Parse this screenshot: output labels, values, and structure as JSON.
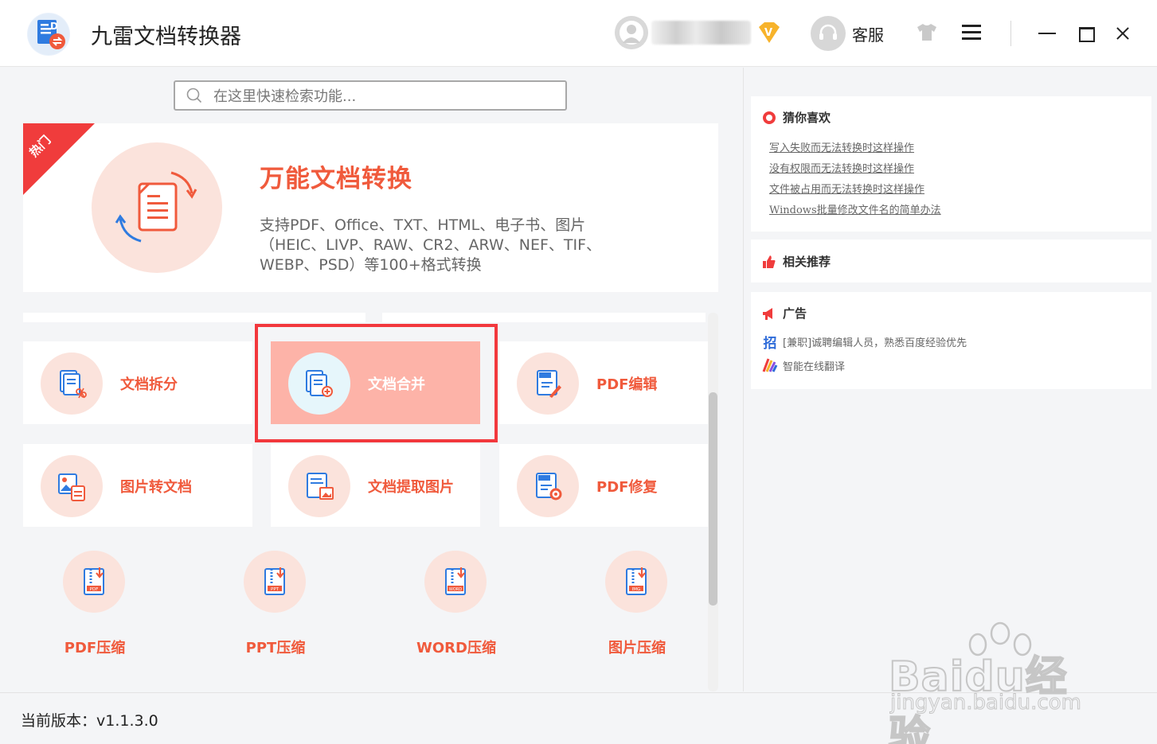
{
  "app": {
    "title": "九雷文档转换器"
  },
  "header": {
    "support_label": "客服",
    "vip_badge": "V"
  },
  "search": {
    "placeholder": "在这里快速检索功能..."
  },
  "hero": {
    "hot_label": "热门",
    "title": "万能文档转换",
    "description": "支持PDF、Office、TXT、HTML、电子书、图片（HEIC、LIVP、RAW、CR2、ARW、NEF、TIF、WEBP、PSD）等100+格式转换"
  },
  "tools": [
    {
      "label": "文档拆分",
      "icon": "document-split-icon"
    },
    {
      "label": "文档合并",
      "icon": "document-merge-icon",
      "selected": true
    },
    {
      "label": "PDF编辑",
      "icon": "pdf-edit-icon"
    },
    {
      "label": "图片转文档",
      "icon": "image-to-doc-icon"
    },
    {
      "label": "文档提取图片",
      "icon": "extract-image-icon"
    },
    {
      "label": "PDF修复",
      "icon": "pdf-repair-icon"
    }
  ],
  "compress": [
    {
      "label": "PDF压缩",
      "tag": "PDF"
    },
    {
      "label": "PPT压缩",
      "tag": "PPT"
    },
    {
      "label": "WORD压缩",
      "tag": "WORD"
    },
    {
      "label": "图片压缩",
      "tag": "IMG"
    }
  ],
  "right_panel": {
    "guess": {
      "title": "猜你喜欢",
      "links": [
        "写入失败而无法转换时这样操作",
        "没有权限而无法转换时这样操作",
        "文件被占用而无法转换时这样操作",
        "Windows批量修改文件名的简单办法"
      ]
    },
    "related": {
      "title": "相关推荐"
    },
    "ads": {
      "title": "广告",
      "items": [
        {
          "icon_text": "招",
          "text": "[兼职]诚聘编辑人员，熟悉百度经验优先"
        },
        {
          "icon_text": "",
          "text": "智能在线翻译"
        }
      ]
    }
  },
  "footer": {
    "version": "当前版本：v1.1.3.0"
  },
  "watermark": {
    "brand": "Baidu经验",
    "url": "jingyan.baidu.com"
  },
  "colors": {
    "accent": "#f05a3c",
    "selected_bg": "#fdb3a8",
    "highlight_border": "#f2383d",
    "icon_bg": "#fbe3dc"
  }
}
